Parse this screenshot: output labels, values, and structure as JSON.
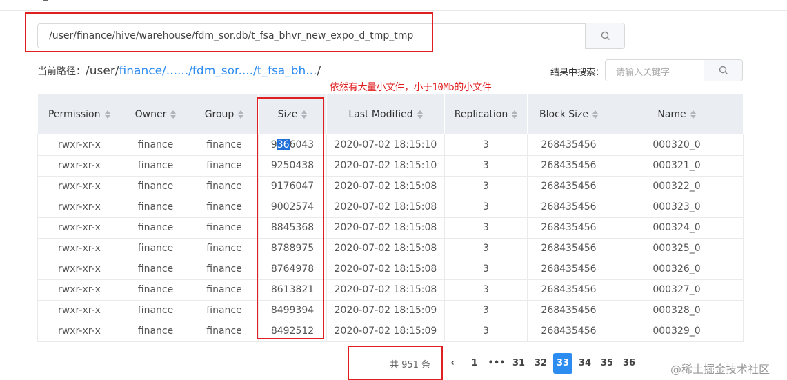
{
  "path_input": {
    "value": "/user/finance/hive/warehouse/fdm_sor.db/t_fsa_bhvr_new_expo_d_tmp_tmp"
  },
  "breadcrumb": {
    "prefix": "当前路径：",
    "root": "/user/",
    "items": [
      "finance/",
      "....../",
      "fdm_sor..../",
      "t_fsa_bh..."
    ],
    "trail": "/"
  },
  "result_search": {
    "label": "结果中搜索：",
    "placeholder": "请输入关键字"
  },
  "annotation_note": "依然有大量小文件，小于10Mb的小文件",
  "table": {
    "headers": [
      "Permission",
      "Owner",
      "Group",
      "Size",
      "Last Modified",
      "Replication",
      "Block Size",
      "Name"
    ],
    "rows": [
      [
        "rwxr-xr-x",
        "finance",
        "finance",
        "9366043",
        "2020-07-02 18:15:10",
        "3",
        "268435456",
        "000320_0"
      ],
      [
        "rwxr-xr-x",
        "finance",
        "finance",
        "9250438",
        "2020-07-02 18:15:10",
        "3",
        "268435456",
        "000321_0"
      ],
      [
        "rwxr-xr-x",
        "finance",
        "finance",
        "9176047",
        "2020-07-02 18:15:08",
        "3",
        "268435456",
        "000322_0"
      ],
      [
        "rwxr-xr-x",
        "finance",
        "finance",
        "9002574",
        "2020-07-02 18:15:08",
        "3",
        "268435456",
        "000323_0"
      ],
      [
        "rwxr-xr-x",
        "finance",
        "finance",
        "8845368",
        "2020-07-02 18:15:08",
        "3",
        "268435456",
        "000324_0"
      ],
      [
        "rwxr-xr-x",
        "finance",
        "finance",
        "8788975",
        "2020-07-02 18:15:08",
        "3",
        "268435456",
        "000325_0"
      ],
      [
        "rwxr-xr-x",
        "finance",
        "finance",
        "8764978",
        "2020-07-02 18:15:08",
        "3",
        "268435456",
        "000326_0"
      ],
      [
        "rwxr-xr-x",
        "finance",
        "finance",
        "8613821",
        "2020-07-02 18:15:08",
        "3",
        "268435456",
        "000327_0"
      ],
      [
        "rwxr-xr-x",
        "finance",
        "finance",
        "8499394",
        "2020-07-02 18:15:09",
        "3",
        "268435456",
        "000328_0"
      ],
      [
        "rwxr-xr-x",
        "finance",
        "finance",
        "8492512",
        "2020-07-02 18:15:09",
        "3",
        "268435456",
        "000329_0"
      ]
    ]
  },
  "pagination": {
    "total": "共 951 条",
    "pages": [
      "‹",
      "1",
      "•••",
      "31",
      "32",
      "33",
      "34",
      "35",
      "36"
    ],
    "active": "33"
  },
  "watermark": "@稀土掘金技术社区",
  "colors": {
    "accent": "#2d8cf0",
    "annotation": "#e02020",
    "header_bg": "#eaedf2"
  }
}
